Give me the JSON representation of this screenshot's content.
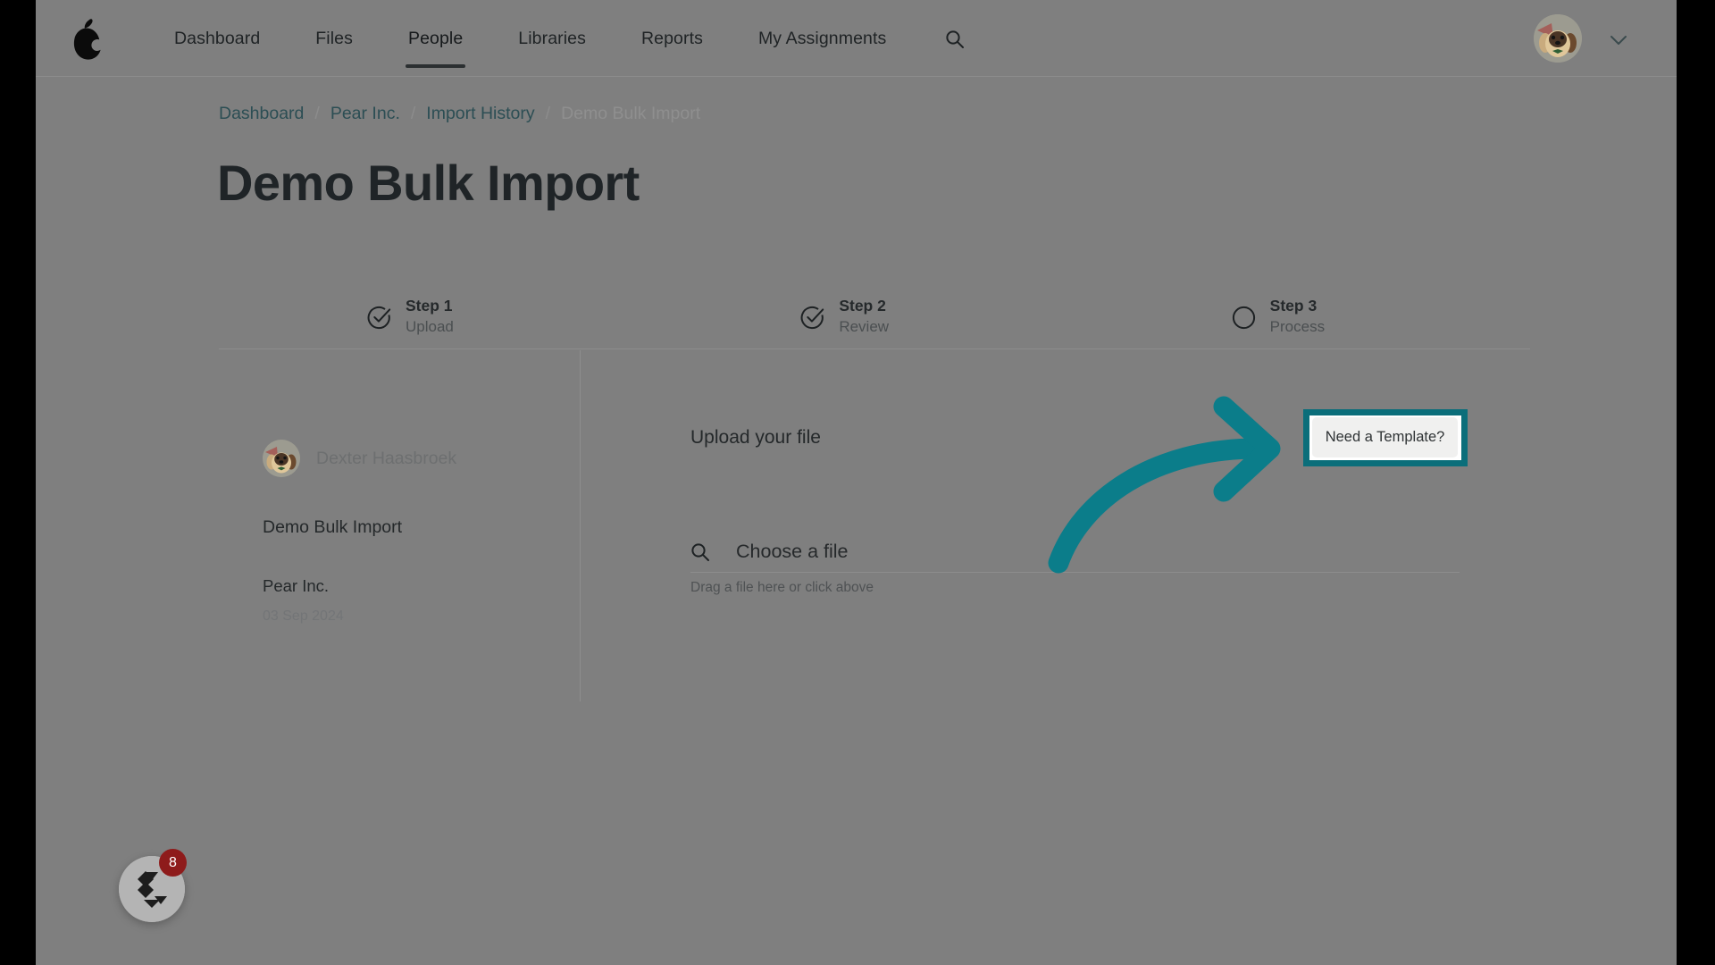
{
  "app": {
    "logo_icon": "pear-logo-icon",
    "accent_color": "#0b6e7a",
    "page_background": "#7f7f7f"
  },
  "navbar": {
    "items": [
      {
        "label": "Dashboard",
        "active": false
      },
      {
        "label": "Files",
        "active": false
      },
      {
        "label": "People",
        "active": true
      },
      {
        "label": "Libraries",
        "active": false
      },
      {
        "label": "Reports",
        "active": false
      },
      {
        "label": "My Assignments",
        "active": false
      }
    ],
    "search_icon": "search-icon",
    "avatar_icon": "user-avatar-dog",
    "chevron_icon": "chevron-down-icon"
  },
  "breadcrumb": {
    "separator": "/",
    "items": [
      {
        "label": "Dashboard",
        "current": false
      },
      {
        "label": "Pear Inc.",
        "current": false
      },
      {
        "label": "Import History",
        "current": false
      },
      {
        "label": "Demo Bulk Import",
        "current": true
      }
    ]
  },
  "page": {
    "title": "Demo Bulk Import"
  },
  "stepper": {
    "steps": [
      {
        "name": "Step 1",
        "sub": "Upload",
        "state": "complete",
        "icon": "check-circle-icon"
      },
      {
        "name": "Step 2",
        "sub": "Review",
        "state": "complete",
        "icon": "check-circle-icon"
      },
      {
        "name": "Step 3",
        "sub": "Process",
        "state": "pending",
        "icon": "empty-circle-icon"
      }
    ]
  },
  "sidebar": {
    "user_name": "Dexter Haasbroek",
    "job_name": "Demo Bulk Import",
    "organisation": "Pear Inc.",
    "date": "03 Sep 2024"
  },
  "upload": {
    "heading": "Upload your file",
    "file_field_label": "Choose a file",
    "file_field_icon": "search-icon",
    "hint": "Drag a file here or click above"
  },
  "template_callout": {
    "button_label": "Need a Template?",
    "highlight_color": "#0b6e7a",
    "arrow_icon": "curved-arrow-icon"
  },
  "help_widget": {
    "icon": "help-chat-icon",
    "badge_count": "8",
    "badge_color": "#8e1b1b"
  }
}
